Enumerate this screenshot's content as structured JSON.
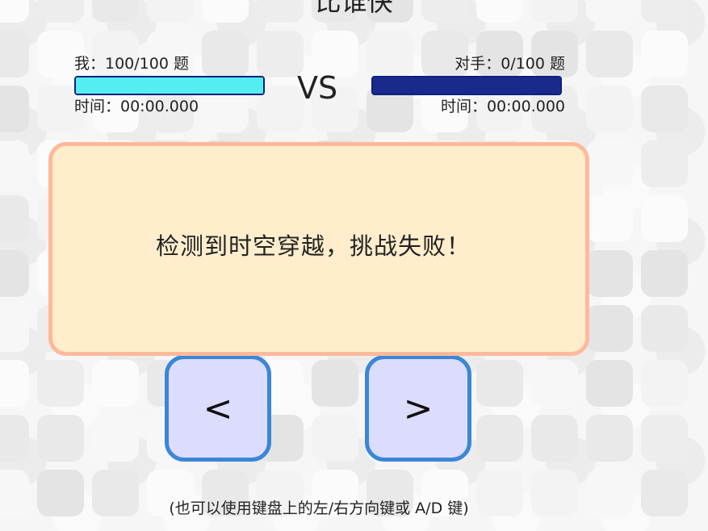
{
  "header": {
    "title": "比谁快"
  },
  "me": {
    "score": "我：100/100 题",
    "progress": 1.0,
    "time": "时间：00:00.000"
  },
  "vs": "VS",
  "opponent": {
    "score": "对手：0/100 题",
    "progress": 0.0,
    "time": "时间：00:00.000"
  },
  "dialog": {
    "message": "检测到时空穿越，挑战失败！"
  },
  "controls": {
    "prev_label": "<",
    "next_label": ">",
    "hint": "(也可以使用键盘上的左/右方向键或 A/D 键)"
  },
  "colors": {
    "progress_fill": "#55eef0",
    "progress_track": "#1a2a8a",
    "dialog_bg": "#ffedcc",
    "dialog_border": "#ffb99a",
    "button_bg": "#dcdcfd",
    "button_border": "#3a87d6"
  }
}
